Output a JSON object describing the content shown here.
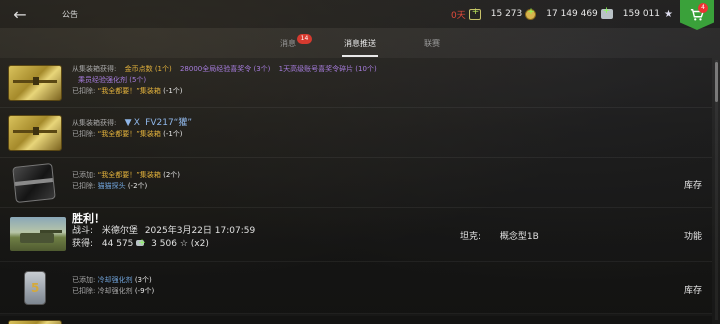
{
  "header": {
    "title": "公告",
    "currencies": {
      "premium": "0天",
      "gold": "15 273",
      "silver": "17 149 469",
      "free_xp": "159 011"
    },
    "shop_badge": "4"
  },
  "tabs": [
    {
      "label": "消息",
      "badge": "14"
    },
    {
      "label": "消息推送",
      "active": true
    },
    {
      "label": "联赛"
    }
  ],
  "messages": [
    {
      "line1_prefix": "从集装箱获得:",
      "line1_items": [
        "金币点数 (1个)",
        "28000全局经验喜奖令 (3个)",
        "1天高级账号喜奖令碎片 (10个)"
      ],
      "line2_items": [
        "乘员经验强化剂 (5个)"
      ],
      "line3_prefix": "已扣除:",
      "line3_item": "“我全都要！”集装箱",
      "line3_count": "(-1个)"
    },
    {
      "line1_prefix": "从集装箱获得:",
      "vehicle_tier": "X",
      "vehicle_name": "FV217“獾”",
      "line2_prefix": "已扣除:",
      "line2_item": "“我全都要！”集装箱",
      "line2_count": "(-1个)"
    },
    {
      "line1_prefix": "已添加:",
      "line1_item": "“我全都要！”集装箱",
      "line1_count": "(2个)",
      "line2_prefix": "已扣除:",
      "line2_item": "猫猫探头",
      "line2_count": "(-2个)",
      "action": "库存"
    },
    {
      "title": "胜利！",
      "battle_label": "战斗:",
      "battle_map": "米德尔堡",
      "battle_time": "2025年3月22日 17:07:59",
      "tank_label": "坦克:",
      "tank_name": "概念型1B",
      "earned_label": "获得:",
      "earned_silver": "44 575",
      "earned_xp": "3 506",
      "earned_multiplier": "(x2)",
      "action": "功能"
    },
    {
      "line1_prefix": "已添加:",
      "line1_item": "冷却强化剂",
      "line1_count": "(3个)",
      "line2_prefix": "已扣除:",
      "line2_item": "冷却强化剂",
      "line2_count": "(-9个)",
      "action": "库存"
    }
  ]
}
